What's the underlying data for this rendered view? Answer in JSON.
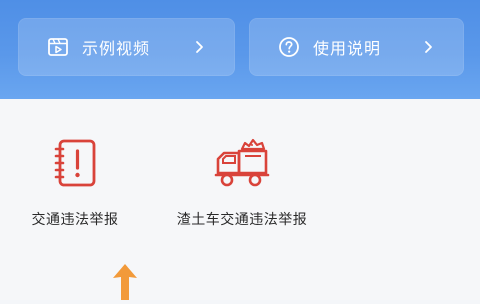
{
  "header": {
    "buttons": [
      {
        "label": "示例视频",
        "icon": "video-icon"
      },
      {
        "label": "使用说明",
        "icon": "help-circle-icon"
      }
    ]
  },
  "tiles": [
    {
      "label": "交通违法举报",
      "icon": "report-notebook-icon"
    },
    {
      "label": "渣土车交通违法举报",
      "icon": "dump-truck-icon"
    }
  ],
  "colors": {
    "header_blue": "#5a98ea",
    "icon_red": "#d9433a",
    "pointer_orange": "#f29a3a"
  }
}
